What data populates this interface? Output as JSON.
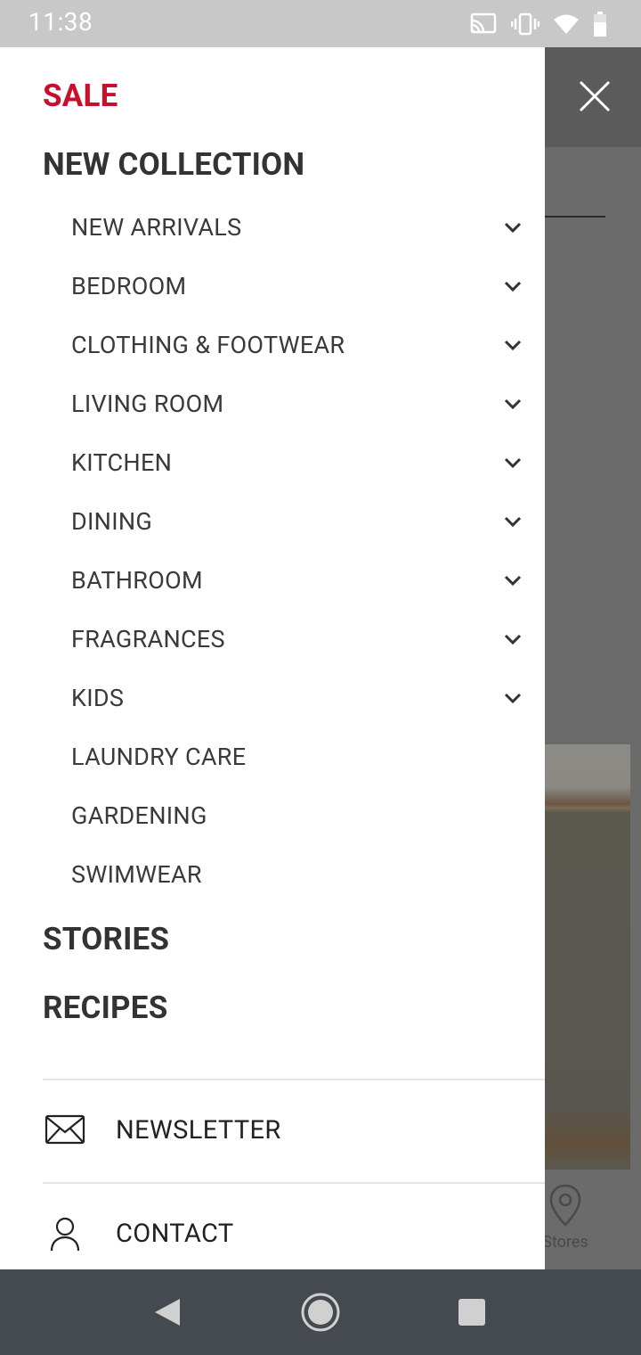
{
  "status_bar": {
    "time": "11:38",
    "icons": [
      "cast-icon",
      "vibrate-icon",
      "wifi-icon",
      "battery-icon"
    ]
  },
  "drawer": {
    "sale": "SALE",
    "new_collection": "NEW COLLECTION",
    "subitems": [
      {
        "label": "NEW ARRIVALS",
        "expandable": true
      },
      {
        "label": "BEDROOM",
        "expandable": true
      },
      {
        "label": "CLOTHING & FOOTWEAR",
        "expandable": true
      },
      {
        "label": "LIVING ROOM",
        "expandable": true
      },
      {
        "label": "KITCHEN",
        "expandable": true
      },
      {
        "label": "DINING",
        "expandable": true
      },
      {
        "label": "BATHROOM",
        "expandable": true
      },
      {
        "label": "FRAGRANCES",
        "expandable": true
      },
      {
        "label": "KIDS",
        "expandable": true
      },
      {
        "label": "LAUNDRY CARE",
        "expandable": false
      },
      {
        "label": "GARDENING",
        "expandable": false
      },
      {
        "label": "SWIMWEAR",
        "expandable": false
      }
    ],
    "stories": "STORIES",
    "recipes": "RECIPES",
    "newsletter": "NEWSLETTER",
    "contact": "CONTACT"
  },
  "background": {
    "stores_label": "Stores"
  },
  "colors": {
    "sale_red": "#c8102e",
    "text_dark": "#333333",
    "status_bar": "#c8c8c8",
    "nav_bar": "#454a50",
    "scrim": "#6b6b6b"
  }
}
